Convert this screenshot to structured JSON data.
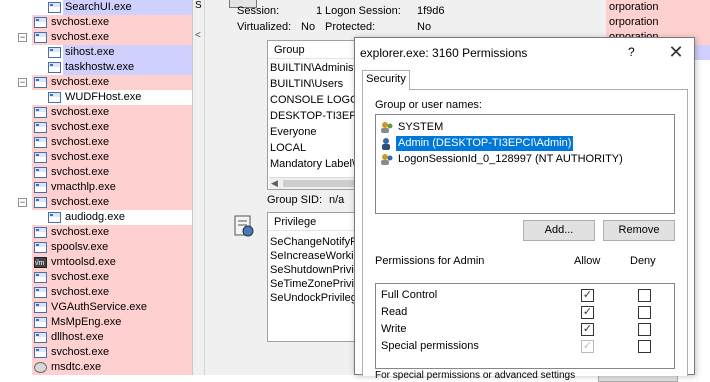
{
  "process_tree": [
    {
      "name": "SearchUI.exe",
      "level": 2,
      "color": "lav",
      "expander": ""
    },
    {
      "name": "svchost.exe",
      "level": 1,
      "color": "pink",
      "expander": ""
    },
    {
      "name": "svchost.exe",
      "level": 1,
      "color": "pink",
      "expander": "−"
    },
    {
      "name": "sihost.exe",
      "level": 2,
      "color": "lav",
      "expander": ""
    },
    {
      "name": "taskhostw.exe",
      "level": 2,
      "color": "lav",
      "expander": ""
    },
    {
      "name": "svchost.exe",
      "level": 1,
      "color": "pink",
      "expander": "−"
    },
    {
      "name": "WUDFHost.exe",
      "level": 2,
      "color": "white",
      "expander": ""
    },
    {
      "name": "svchost.exe",
      "level": 1,
      "color": "pink",
      "expander": ""
    },
    {
      "name": "svchost.exe",
      "level": 1,
      "color": "pink",
      "expander": ""
    },
    {
      "name": "svchost.exe",
      "level": 1,
      "color": "pink",
      "expander": ""
    },
    {
      "name": "svchost.exe",
      "level": 1,
      "color": "pink",
      "expander": ""
    },
    {
      "name": "svchost.exe",
      "level": 1,
      "color": "pink",
      "expander": ""
    },
    {
      "name": "vmacthlp.exe",
      "level": 1,
      "color": "pink",
      "expander": ""
    },
    {
      "name": "svchost.exe",
      "level": 1,
      "color": "pink",
      "expander": "−"
    },
    {
      "name": "audiodg.exe",
      "level": 2,
      "color": "white",
      "expander": ""
    },
    {
      "name": "svchost.exe",
      "level": 1,
      "color": "pink",
      "expander": ""
    },
    {
      "name": "spoolsv.exe",
      "level": 1,
      "color": "pink",
      "expander": ""
    },
    {
      "name": "vmtoolsd.exe",
      "level": 1,
      "color": "pink",
      "expander": "",
      "icon": "vm"
    },
    {
      "name": "svchost.exe",
      "level": 1,
      "color": "pink",
      "expander": ""
    },
    {
      "name": "svchost.exe",
      "level": 1,
      "color": "pink",
      "expander": ""
    },
    {
      "name": "VGAuthService.exe",
      "level": 1,
      "color": "pink",
      "expander": ""
    },
    {
      "name": "MsMpEng.exe",
      "level": 1,
      "color": "pink",
      "expander": ""
    },
    {
      "name": "dllhost.exe",
      "level": 1,
      "color": "pink",
      "expander": ""
    },
    {
      "name": "svchost.exe",
      "level": 1,
      "color": "pink",
      "expander": ""
    },
    {
      "name": "msdtc.exe",
      "level": 1,
      "color": "pink",
      "expander": "",
      "icon": "gear"
    }
  ],
  "mid_strip": {
    "c1": "S",
    "c2": "<"
  },
  "props": {
    "session_label": "Session:",
    "session_value": "1",
    "logon_label": "Logon Session:",
    "logon_value": "1f9d6",
    "virtualized_label": "Virtualized:",
    "virtualized_value": "No",
    "protected_label": "Protected:",
    "protected_value": "No",
    "group_header": "Group",
    "groups": [
      "BUILTIN\\Administ",
      "BUILTIN\\Users",
      "CONSOLE LOGON",
      "DESKTOP-TI3EPC",
      "Everyone",
      "LOCAL",
      "Mandatory Label\\N"
    ],
    "group_sid_label": "Group SID:",
    "group_sid_value": "n/a",
    "privilege_header": "Privilege",
    "privileges": [
      "SeChangeNotifyPr",
      "SeIncreaseWorkin",
      "SeShutdownPrivile",
      "SeTimeZonePrivile",
      "SeUndockPrivilege"
    ]
  },
  "right_col": [
    {
      "text": "orporation",
      "color": "pink"
    },
    {
      "text": "orporation",
      "color": "pink"
    },
    {
      "text": "orporation",
      "color": "pink"
    },
    {
      "text": "orporation",
      "color": "lav"
    }
  ],
  "dialog": {
    "title": "explorer.exe: 3160 Permissions",
    "help": "?",
    "close": "✕",
    "tab": "Security",
    "group_names_label": "Group or user names:",
    "users": [
      {
        "name": "SYSTEM",
        "selected": false
      },
      {
        "name": "Admin (DESKTOP-TI3EPCI\\Admin)",
        "selected": true
      },
      {
        "name": "LogonSessionId_0_128997 (NT AUTHORITY)",
        "selected": false
      }
    ],
    "add_button": "Add...",
    "remove_button": "Remove",
    "permissions_for": "Permissions for Admin",
    "allow_header": "Allow",
    "deny_header": "Deny",
    "permissions": [
      {
        "name": "Full Control",
        "allow": true,
        "allow_disabled": false,
        "deny": false
      },
      {
        "name": "Read",
        "allow": true,
        "allow_disabled": false,
        "deny": false
      },
      {
        "name": "Write",
        "allow": true,
        "allow_disabled": false,
        "deny": false
      },
      {
        "name": "Special permissions",
        "allow": true,
        "allow_disabled": true,
        "deny": false
      }
    ],
    "footer_text": "For special permissions or advanced settings",
    "advanced_partial": "Advanced"
  }
}
